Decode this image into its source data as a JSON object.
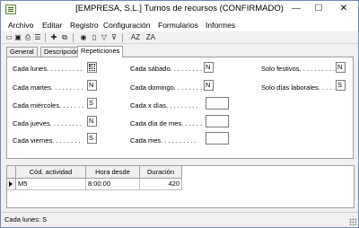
{
  "window": {
    "title": "[EMPRESA, S.L.] Turnos de recursos (CONFIRMADO)",
    "minimize": "—",
    "maximize": "☐",
    "close": "✕"
  },
  "menu": [
    "Archivo",
    "Editar",
    "Registro",
    "Configuración",
    "Formularios",
    "Informes"
  ],
  "toolbar": {
    "sort_asc": "AZ",
    "sort_desc": "ZA"
  },
  "tabs": [
    "General",
    "Descripción",
    "Repeticiones"
  ],
  "active_tab": "Repeticiones",
  "fields": {
    "lunes": {
      "label": "Cada lunes. . . . . . . . . .",
      "value": "S"
    },
    "martes": {
      "label": "Cada martes. . . . . . . . .",
      "value": "N"
    },
    "miercoles": {
      "label": "Cada miércoles. . . . . . .",
      "value": "S"
    },
    "jueves": {
      "label": "Cada jueves. . . . . . . . .",
      "value": "N"
    },
    "viernes": {
      "label": "Cada viernes. . . . . . . .",
      "value": "S"
    },
    "sabado": {
      "label": "Cada sábado. . . . . . . . .",
      "value": "N"
    },
    "domingo": {
      "label": "Cada domingo. . . . . . . .",
      "value": "N"
    },
    "x_dias": {
      "label": "Cada x días. . . . . . . . .",
      "value": ""
    },
    "dia_mes": {
      "label": "Cada día de mes. . . . . .",
      "value": ""
    },
    "mes": {
      "label": "Cada mes. . . . . . . . . .",
      "value": ""
    },
    "festivos": {
      "label": "Solo festivos. . . . . . . . . . .",
      "value": "N"
    },
    "laborales": {
      "label": "Solo días laborales. . . . . . .",
      "value": "S"
    }
  },
  "grid": {
    "columns": [
      "Cód. actividad",
      "Hora desde",
      "Duración"
    ],
    "rows": [
      [
        "M5",
        "8:00:00",
        "420"
      ]
    ]
  },
  "status": "Cada lunes: S"
}
